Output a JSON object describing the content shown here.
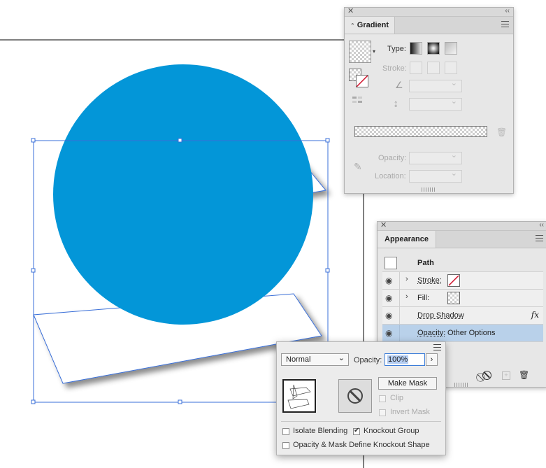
{
  "colors": {
    "artwork_fill": "#0396d8",
    "selection": "#3a6fd8",
    "selected_row": "#b9d1ea"
  },
  "gradient_panel": {
    "title": "Gradient",
    "type_label": "Type:",
    "stroke_label": "Stroke:",
    "opacity_label": "Opacity:",
    "location_label": "Location:"
  },
  "appearance_panel": {
    "title": "Appearance",
    "object_label": "Path",
    "rows": [
      {
        "label": "Stroke:"
      },
      {
        "label": "Fill:"
      },
      {
        "label": "Drop Shadow",
        "fx": "fx"
      },
      {
        "label": "Opacity:",
        "value": "Other Options"
      }
    ]
  },
  "transparency_popup": {
    "blend_mode": "Normal",
    "opacity_label": "Opacity:",
    "opacity_value": "100%",
    "make_mask": "Make Mask",
    "clip": "Clip",
    "invert_mask": "Invert Mask",
    "isolate_blending": "Isolate Blending",
    "isolate_blending_checked": false,
    "knockout_group": "Knockout Group",
    "knockout_group_checked": true,
    "opacity_mask_knockout": "Opacity & Mask Define Knockout Shape",
    "opacity_mask_knockout_checked": false
  }
}
